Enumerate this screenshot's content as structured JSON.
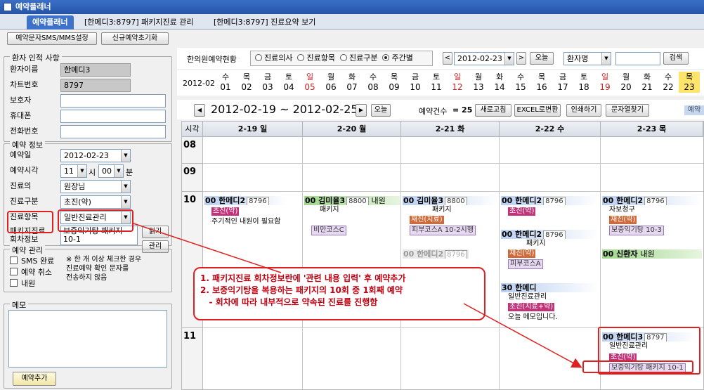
{
  "window": {
    "title": "예약플래너"
  },
  "tabs": [
    {
      "label": "예약플래너",
      "active": true
    },
    {
      "label": "[한메디3:8797]  패키지진료 관리",
      "active": false
    },
    {
      "label": "[한메디3:8797]  진료요약 보기",
      "active": false
    }
  ],
  "toolbar": {
    "sms_btn": "예약문자SMS/MMS설정",
    "reset_btn": "신규예약초기화"
  },
  "patient": {
    "title": "환자 인적 사항",
    "name_label": "환자이름",
    "name_value": "한메디3",
    "chart_label": "차트번호",
    "chart_value": "8797",
    "guardian_label": "보호자",
    "mobile_label": "휴대폰",
    "phone_label": "전화번호"
  },
  "reservation": {
    "title": "예약 정보",
    "date_label": "예약일",
    "date_value": "2012-02-23",
    "time_label": "예약시각",
    "hour_value": "11",
    "hour_unit": "시",
    "min_value": "00",
    "min_unit": "분",
    "doctor_label": "진료의",
    "doctor_value": "원장님",
    "type_label": "진료구분",
    "type_value": "초진(약)",
    "item_label": "진료항목",
    "item_value": "일반진료관리",
    "pkg_label_1": "패키지진료",
    "pkg_label_2": "회차정보",
    "pkg_value_1": "보중익기탕 패키지",
    "pkg_value_2": "10-1",
    "read_btn": "읽기",
    "manage_btn": "관리"
  },
  "manage": {
    "title": "예약 관리",
    "sms_done": "SMS 완료",
    "cancel": "예약 취소",
    "visited": "내원",
    "note_1": "※ 한 개 이상 체크한 경우",
    "note_2": "진료예약 확인 문자를",
    "note_3": "전송하지 않음"
  },
  "memo": {
    "title": "메모",
    "add_btn": "예약추가"
  },
  "schedule_header": {
    "label": "한의원예약현황",
    "radios": [
      {
        "label": "진료의사",
        "checked": false
      },
      {
        "label": "진료항목",
        "checked": false
      },
      {
        "label": "진료구분",
        "checked": false
      },
      {
        "label": "주간별",
        "checked": true
      }
    ],
    "prev": "<",
    "date": "2012-02-23",
    "next": ">",
    "today_btn": "오늘",
    "search_field": "환자명",
    "search_btn": "검색"
  },
  "date_strip": {
    "month": "2012-02",
    "days": [
      {
        "wd": "수",
        "d": "01"
      },
      {
        "wd": "목",
        "d": "02"
      },
      {
        "wd": "금",
        "d": "03"
      },
      {
        "wd": "토",
        "d": "04"
      },
      {
        "wd": "일",
        "d": "05",
        "red": true
      },
      {
        "wd": "월",
        "d": "06"
      },
      {
        "wd": "화",
        "d": "07"
      },
      {
        "wd": "수",
        "d": "08"
      },
      {
        "wd": "목",
        "d": "09"
      },
      {
        "wd": "금",
        "d": "10"
      },
      {
        "wd": "토",
        "d": "11"
      },
      {
        "wd": "일",
        "d": "12",
        "red": true
      },
      {
        "wd": "월",
        "d": "13"
      },
      {
        "wd": "화",
        "d": "14"
      },
      {
        "wd": "수",
        "d": "15"
      },
      {
        "wd": "목",
        "d": "16"
      },
      {
        "wd": "금",
        "d": "17"
      },
      {
        "wd": "토",
        "d": "18"
      },
      {
        "wd": "일",
        "d": "19",
        "red": true
      },
      {
        "wd": "월",
        "d": "20"
      },
      {
        "wd": "화",
        "d": "21"
      },
      {
        "wd": "수",
        "d": "22"
      },
      {
        "wd": "목",
        "d": "23",
        "today": true
      }
    ]
  },
  "week": {
    "range": "2012-02-19 ~ 2012-02-25",
    "today_btn": "오늘",
    "count_label": "예약건수",
    "count": "= 25",
    "refresh": "새로고침",
    "excel": "EXCEL로변환",
    "print": "인쇄하기",
    "msg": "문자열찾기",
    "extra": "예약"
  },
  "grid": {
    "time_col": "시각",
    "days": [
      "2-19 일",
      "2-20 월",
      "2-21 화",
      "2-22 수",
      "2-23 목"
    ],
    "hours": [
      "08",
      "09",
      "10",
      "11"
    ]
  },
  "events": {
    "e1": {
      "min": "00",
      "name": "한메디2",
      "code": "8796",
      "tag": "초진(약)",
      "text": "주기적인 내원이 필요함"
    },
    "e2": {
      "min": "00",
      "name": "김미율3",
      "code": "8800",
      "extra": "내원",
      "text": "패키지",
      "tag": "비만코스C"
    },
    "e3": {
      "min": "00",
      "name": "김미율3",
      "code": "8800",
      "text": "패키지",
      "tag": "재진(치료)",
      "tag2": "피부코스A 10-2시행"
    },
    "e4": {
      "min": "00",
      "name": "한메디2",
      "code": "8796"
    },
    "e5": {
      "min": "00",
      "name": "한메디2",
      "code": "8796",
      "tag": "초진(약)"
    },
    "e6": {
      "min": "00",
      "name": "한메디2",
      "code": "8796",
      "text": "패키지",
      "tag": "재진(약)",
      "tag2": "피부코스A"
    },
    "e7": {
      "min": "30",
      "name": "한메디",
      "text": "일반진료관리",
      "tag": "초진(치료+약)",
      "text2": "오늘 메모입니다."
    },
    "e8": {
      "min": "00",
      "name": "한메디2",
      "code": "8796",
      "text": "자보청구",
      "tag": "재진(약)",
      "tag2": "보중익기탕 10-3"
    },
    "e9": {
      "min": "00",
      "name": "신환자",
      "extra": "내원"
    },
    "e10": {
      "min": "00",
      "name": "한메디3",
      "code": "8797",
      "text": "일반진료관리",
      "tag": "초진(약)",
      "tag2": "보중익기탕 패키지 10-1"
    }
  },
  "callout": {
    "line1": "1. 패키지진료 회차정보란에 '관련 내용 입력' 후 예약추가",
    "line2": "2. 보중익기탕을 복용하는 패키지의 10회 중 1회째 예약",
    "line3": "   - 회차에 따라 내부적으로 약속된 진료를 진행함"
  },
  "colors": {
    "accent": "#3e72c8",
    "annotation": "#e02020",
    "today": "#ffe46b",
    "sunday": "#cc2020"
  }
}
